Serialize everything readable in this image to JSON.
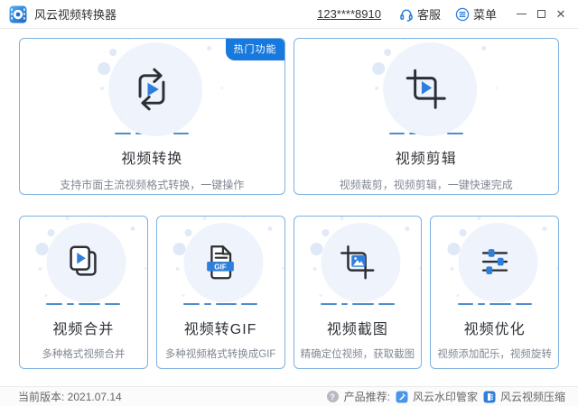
{
  "titlebar": {
    "app_title": "风云视频转换器",
    "account": "123****8910",
    "support_label": "客服",
    "menu_label": "菜单"
  },
  "icons": {
    "app_logo": "film-reel",
    "support": "headset",
    "menu": "circled-list",
    "minimize": "minus-line",
    "maximize": "square-outline",
    "close_glyph": "✕",
    "help_glyph": "?",
    "product_logos": [
      "watermark-pen",
      "film-strip"
    ]
  },
  "cards": {
    "featured_badge": "热门功能",
    "gif_label": "GIF",
    "items": [
      {
        "title": "视频转换",
        "desc": "支持市面主流视频格式转换，一键操作"
      },
      {
        "title": "视频剪辑",
        "desc": "视频裁剪，视频剪辑，一键快速完成"
      },
      {
        "title": "视频合并",
        "desc": "多种格式视频合并"
      },
      {
        "title": "视频转GIF",
        "desc": "多种视频格式转换成GIF"
      },
      {
        "title": "视频截图",
        "desc": "精确定位视频，获取截图"
      },
      {
        "title": "视频优化",
        "desc": "视频添加配乐，视频旋转"
      }
    ]
  },
  "statusbar": {
    "version_label": "当前版本: 2021.07.14",
    "recommend_label": "产品推荐: ",
    "products": [
      {
        "name": "风云水印管家"
      },
      {
        "name": "风云视频压缩"
      }
    ]
  },
  "colors": {
    "accent": "#2e7fdb",
    "badge_bg": "#1778dd",
    "card_border": "#7db2e2"
  }
}
